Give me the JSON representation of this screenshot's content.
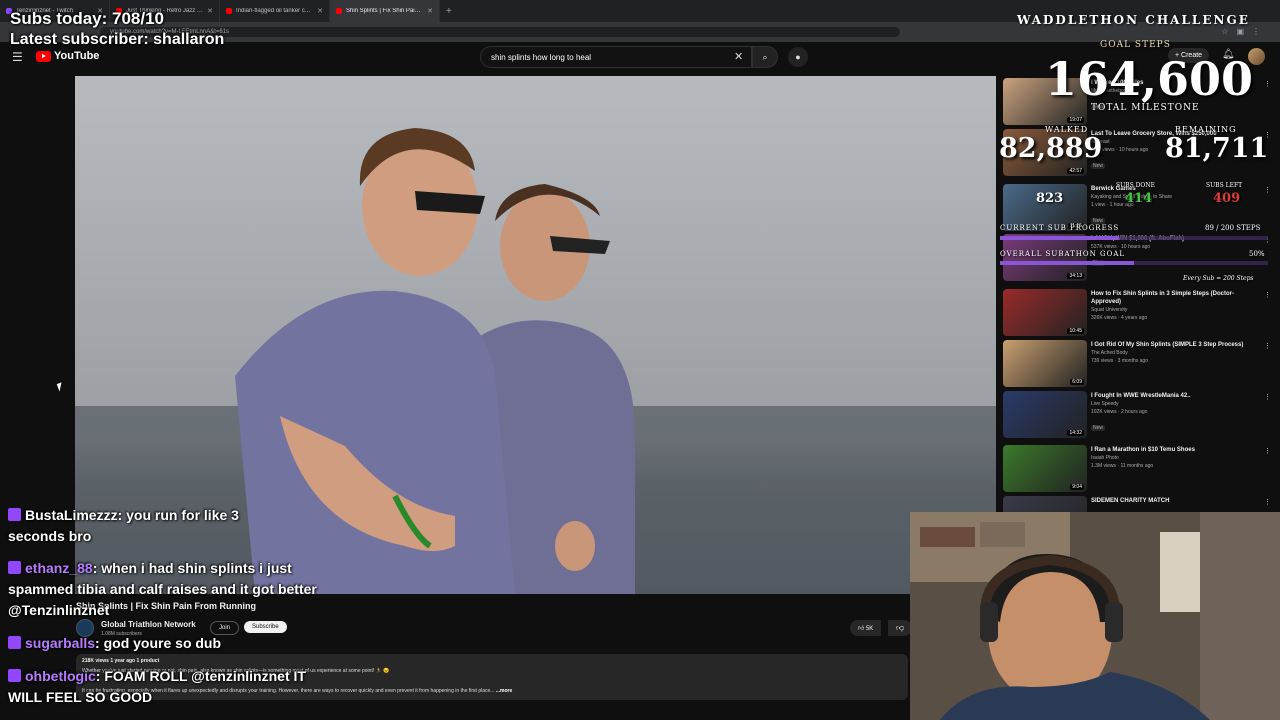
{
  "browser": {
    "tabs": [
      {
        "label": "Tenzinlinznet - Twitch",
        "color": "#9146ff",
        "active": false
      },
      {
        "label": "Just Thinking - Retro Jazz - YouTube",
        "color": "#ff0000",
        "active": false
      },
      {
        "label": "Indian-flagged oil tanker comes",
        "color": "#ff0000",
        "active": false
      },
      {
        "label": "Shin Splints | Fix Shin Pain From Running",
        "color": "#ff0000",
        "active": true
      }
    ],
    "url": "youtube.com/watch?v=M-LFEtmLnnA&t=61s"
  },
  "youtube": {
    "logo": "YouTube",
    "search_value": "shin splints how long to heal",
    "create_label": "Create"
  },
  "video": {
    "title": "Shin Splints | Fix Shin Pain From Running",
    "channel": "Global Triathlon Network",
    "subs": "1.08M subscribers",
    "join_label": "Join",
    "subscribe_label": "Subscribe",
    "likes": "5K",
    "meta": "218K views  1 year ago  1 product",
    "desc_line1": "Whether you've just started running or not, shin pain, also known as shin splints—is something most of us experience at some point! 🏃 😣",
    "desc_line2": "It can be frustrating, especially when it flares up unexpectedly and disrupts your training. However, there are ways to recover quickly and even prevent it from happening in the first place...",
    "more_label": "...more"
  },
  "sidebar": [
    {
      "title": "I Walked 100 Miles",
      "channel": "Mrwhosetheboss",
      "views": "",
      "duration": "19:07",
      "badge": "New",
      "thumb": "#c9a37f"
    },
    {
      "title": "Last To Leave Grocery Store, Wins $250,000",
      "channel": "MrBeast",
      "views": "18M views · 10 hours ago",
      "duration": "42:57",
      "badge": "New",
      "thumb": "#8a5a3a"
    },
    {
      "title": "Berwick Games",
      "channel": "Kayaking and Small Videos to Share",
      "views": "1 view · 1 hour ago",
      "duration": "11:15",
      "badge": "New",
      "thumb": "#4a6a8a"
    },
    {
      "title": "LAUGH, WIN $1,000 (ft. AboFlah)",
      "channel": "",
      "views": "537K views · 10 hours ago",
      "duration": "34:13",
      "badge": "New",
      "thumb": "#7a3a7a"
    },
    {
      "title": "How to Fix Shin Splints in 3 Simple Steps (Doctor-Approved)",
      "channel": "Squat University",
      "views": "326K views · 4 years ago",
      "duration": "10:45",
      "badge": "",
      "thumb": "#9a2a2a"
    },
    {
      "title": "I Got Rid Of My Shin Splints (SIMPLE 3 Step Process)",
      "channel": "The Ached Body",
      "views": "739 views · 3 months ago",
      "duration": "6:09",
      "badge": "",
      "thumb": "#c9a070"
    },
    {
      "title": "I Fought In WWE WrestleMania 42..",
      "channel": "Live Speedy",
      "views": "102K views · 2 hours ago",
      "duration": "14:32",
      "badge": "New",
      "thumb": "#2a3a6a"
    },
    {
      "title": "I Ran a Marathon in $10 Temu Shoes",
      "channel": "Isaiah Photo",
      "views": "1.3M views · 11 months ago",
      "duration": "9:04",
      "badge": "",
      "thumb": "#3a7a2a"
    },
    {
      "title": "SIDEMEN CHARITY MATCH",
      "channel": "",
      "views": "",
      "duration": "",
      "badge": "",
      "thumb": "#3a3a4a"
    }
  ],
  "overlay": {
    "subs_today": "Subs today: 708/10",
    "latest_sub": "Latest subscriber: shallaron",
    "challenge": "WADDLETHON CHALLENGE",
    "goal_steps_label": "GOAL STEPS",
    "goal_steps": "164,600",
    "total_milestone": "TOTAL MILESTONE",
    "walked_label": "WALKED",
    "walked": "82,889",
    "remaining_label": "REMAINING",
    "remaining": "81,711",
    "subs_done_label": "SUBS DONE",
    "subs_left_label": "SUBS LEFT",
    "v823": "823",
    "subs_done": "414",
    "subs_left": "409",
    "current_sub_progress_label": "CURRENT SUB PROGRESS",
    "current_sub_progress": "89 / 200 STEPS",
    "current_sub_fraction": 0.445,
    "overall_goal_label": "OVERALL SUBATHON GOAL",
    "overall_goal": "50%",
    "overall_fraction": 0.5,
    "footer": "Every Sub = 200 Steps"
  },
  "chat": [
    {
      "user": "BustaLimezzz",
      "text": " you run for like 3 seconds bro"
    },
    {
      "user": "ethanz_88",
      "text": " when i had shin splints i just spammed tibia and calf raises and it got better @Tenzinlinznet"
    },
    {
      "user": "sugarballs",
      "text": " god youre so dub"
    },
    {
      "user": "ohbetlogic",
      "text": " FOAM ROLL @tenzinlinznet IT WILL FEEL SO GOOD"
    }
  ]
}
